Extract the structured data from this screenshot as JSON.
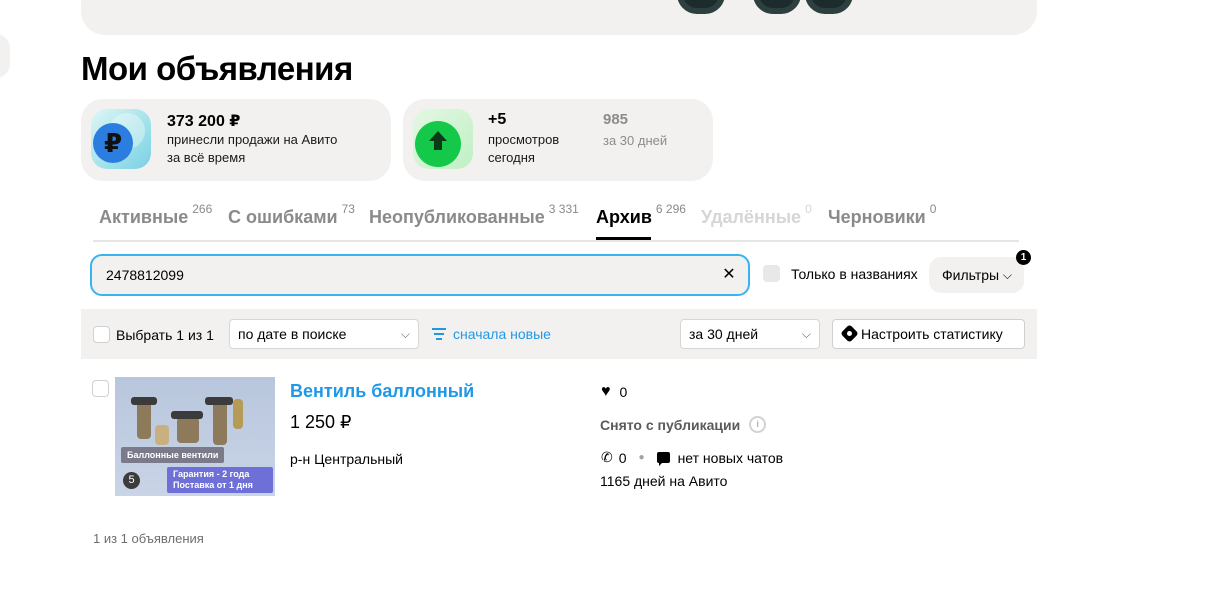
{
  "page": {
    "title": "Мои объявления"
  },
  "stats": {
    "revenue": {
      "value": "373 200 ₽",
      "line1": "принесли продажи на Авито",
      "line2": "за всё время",
      "icon": "ruble-icon"
    },
    "views": {
      "value": "+5",
      "line1": "просмотров",
      "line2": "сегодня",
      "total": "985",
      "total_label": "за 30 дней",
      "icon": "arrow-up-icon"
    }
  },
  "tabs": [
    {
      "label": "Активные",
      "count": "266",
      "state": "normal"
    },
    {
      "label": "С ошибками",
      "count": "73",
      "state": "normal"
    },
    {
      "label": "Неопубликованные",
      "count": "3 331",
      "state": "normal"
    },
    {
      "label": "Архив",
      "count": "6 296",
      "state": "active"
    },
    {
      "label": "Удалённые",
      "count": "0",
      "state": "disabled"
    },
    {
      "label": "Черновики",
      "count": "0",
      "state": "normal"
    }
  ],
  "search": {
    "value": "2478812099",
    "clear_glyph": "✕"
  },
  "title_only": {
    "label": "Только в названиях"
  },
  "filters": {
    "label": "Фильтры",
    "chevron": "⌵",
    "badge": "1"
  },
  "toolbar": {
    "select_label": "Выбрать 1 из 1",
    "sort_select": "по дате в поиске",
    "sort_order": "сначала новые",
    "period_select": "за 30 дней",
    "stats_button": "Настроить статистику",
    "chevron": "⌵"
  },
  "listing": {
    "title": "Вентиль баллонный",
    "price": "1 250 ₽",
    "location": "р-н Центральный",
    "favorites": "0",
    "status": "Снято с публикации",
    "calls": "0",
    "chats": "нет новых чатов",
    "days": "1165 дней на Авито",
    "photo_count": "5",
    "photo_tag1": "Баллонные вентили",
    "photo_tag2_line1": "Гарантия - 2 года",
    "photo_tag2_line2": "Поставка от 1 дня"
  },
  "footer": {
    "count_text": "1 из 1 объявления"
  },
  "colors": {
    "accent": "#1f98e8",
    "focus": "#38b4f1",
    "panel": "#f2f1f0"
  }
}
